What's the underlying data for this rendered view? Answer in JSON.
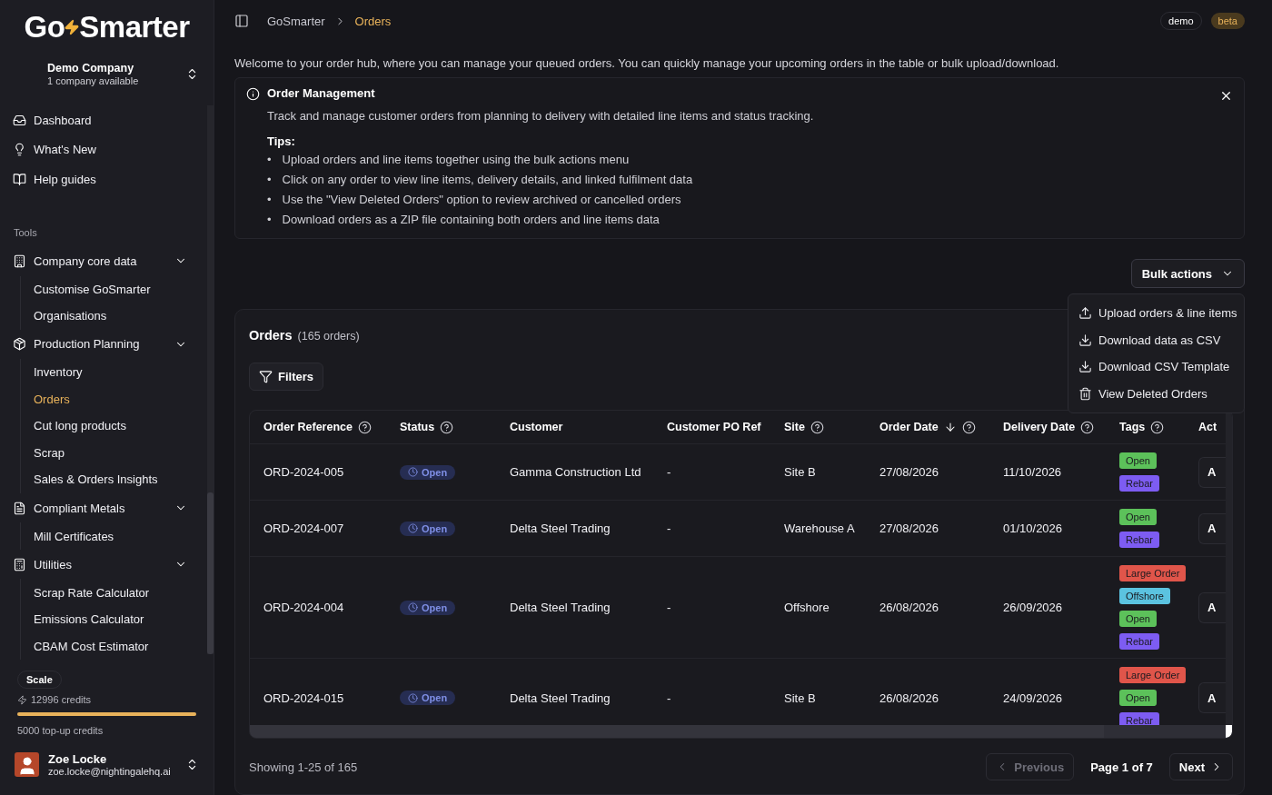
{
  "sidebar": {
    "logo": [
      "Go",
      "Smarter"
    ],
    "company": {
      "name": "Demo Company",
      "subtitle": "1 company available"
    },
    "top_items": [
      {
        "label": "Dashboard",
        "selected": false
      },
      {
        "label": "What's New",
        "selected": false
      },
      {
        "label": "Help guides",
        "selected": false
      }
    ],
    "section_label": "Tools",
    "groups": [
      {
        "label": "Company core data",
        "expanded": true,
        "children": [
          {
            "label": "Customise GoSmarter",
            "selected": false
          },
          {
            "label": "Organisations",
            "selected": false
          }
        ]
      },
      {
        "label": "Production Planning",
        "expanded": true,
        "children": [
          {
            "label": "Inventory",
            "selected": false
          },
          {
            "label": "Orders",
            "selected": true
          },
          {
            "label": "Cut long products",
            "selected": false
          },
          {
            "label": "Scrap",
            "selected": false
          },
          {
            "label": "Sales & Orders Insights",
            "selected": false
          }
        ]
      },
      {
        "label": "Compliant Metals",
        "expanded": true,
        "children": [
          {
            "label": "Mill Certificates",
            "selected": false
          }
        ]
      },
      {
        "label": "Utilities",
        "expanded": true,
        "children": [
          {
            "label": "Scrap Rate Calculator",
            "selected": false
          },
          {
            "label": "Emissions Calculator",
            "selected": false
          },
          {
            "label": "CBAM Cost Estimator",
            "selected": false
          }
        ]
      }
    ],
    "plan": {
      "name": "Scale",
      "credits": "12996 credits",
      "level": 1.0,
      "topup": "5000 top-up credits"
    },
    "user": {
      "name": "Zoe Locke",
      "email": "zoe.locke@nightingalehq.ai"
    }
  },
  "header": {
    "breadcrumbs": [
      {
        "label": "GoSmarter",
        "selected": false
      },
      {
        "label": "Orders",
        "selected": true
      }
    ],
    "badges": [
      {
        "label": "demo",
        "kind": "outline"
      },
      {
        "label": "beta",
        "kind": "accent"
      }
    ]
  },
  "intro": "Welcome to your order hub, where you can manage your queued orders. You can quickly manage your upcoming orders in the table or bulk upload/download.",
  "info_card": {
    "title": "Order Management",
    "description": "Track and manage customer orders from planning to delivery with detailed line items and status tracking.",
    "tips_label": "Tips:",
    "tip_marker": "•",
    "tips": [
      "Upload orders and line items together using the bulk actions menu",
      "Click on any order to view line items, delivery details, and linked fulfilment data",
      "Use the \"View Deleted Orders\" option to review archived or cancelled orders",
      "Download orders as a ZIP file containing both orders and line items data"
    ]
  },
  "bulk_actions": {
    "label": "Bulk actions",
    "expanded": true,
    "items": [
      "Upload orders & line items",
      "Download data as CSV",
      "Download CSV Template",
      "View Deleted Orders"
    ]
  },
  "orders": {
    "title": "Orders",
    "count": "(165 orders)",
    "filters": "Filters",
    "columns": [
      {
        "label": "Order Reference",
        "help": true,
        "sorted": false
      },
      {
        "label": "Status",
        "help": true,
        "sorted": false
      },
      {
        "label": "Customer",
        "help": false,
        "sorted": false
      },
      {
        "label": "Customer PO Ref",
        "help": false,
        "sorted": false
      },
      {
        "label": "Site",
        "help": true,
        "sorted": false
      },
      {
        "label": "Order Date",
        "help": true,
        "sorted": true
      },
      {
        "label": "Delivery Date",
        "help": true,
        "sorted": false
      },
      {
        "label": "Tags",
        "help": true,
        "sorted": false
      },
      {
        "label": "Act",
        "help": false,
        "sorted": false
      }
    ],
    "rows": [
      {
        "reference": "ORD-2024-005",
        "status": "Open",
        "customer": "Gamma Construction Ltd",
        "po_ref": "-",
        "site": "Site B",
        "order_date": "27/08/2026",
        "delivery_date": "11/10/2026",
        "tags": [
          {
            "label": "Open",
            "color": "#5cc15a"
          },
          {
            "label": "Rebar",
            "color": "#7d5cf2"
          }
        ],
        "action": "A"
      },
      {
        "reference": "ORD-2024-007",
        "status": "Open",
        "customer": "Delta Steel Trading",
        "po_ref": "-",
        "site": "Warehouse A",
        "order_date": "27/08/2026",
        "delivery_date": "01/10/2026",
        "tags": [
          {
            "label": "Open",
            "color": "#5cc15a"
          },
          {
            "label": "Rebar",
            "color": "#7d5cf2"
          }
        ],
        "action": "A"
      },
      {
        "reference": "ORD-2024-004",
        "status": "Open",
        "customer": "Delta Steel Trading",
        "po_ref": "-",
        "site": "Offshore",
        "order_date": "26/08/2026",
        "delivery_date": "26/09/2026",
        "tags": [
          {
            "label": "Large Order",
            "color": "#e0554a"
          },
          {
            "label": "Offshore",
            "color": "#5bc3e0"
          },
          {
            "label": "Open",
            "color": "#5cc15a"
          },
          {
            "label": "Rebar",
            "color": "#7d5cf2"
          }
        ],
        "action": "A"
      },
      {
        "reference": "ORD-2024-015",
        "status": "Open",
        "customer": "Delta Steel Trading",
        "po_ref": "-",
        "site": "Site B",
        "order_date": "26/08/2026",
        "delivery_date": "24/09/2026",
        "tags": [
          {
            "label": "Large Order",
            "color": "#e0554a"
          },
          {
            "label": "Open",
            "color": "#5cc15a"
          },
          {
            "label": "Rebar",
            "color": "#7d5cf2"
          }
        ],
        "action": "A"
      }
    ],
    "showing": "Showing 1-25 of 165",
    "pagination": {
      "previous": {
        "label": "Previous",
        "disabled": true
      },
      "page": "Page 1 of 7",
      "next": {
        "label": "Next",
        "disabled": false
      }
    }
  }
}
